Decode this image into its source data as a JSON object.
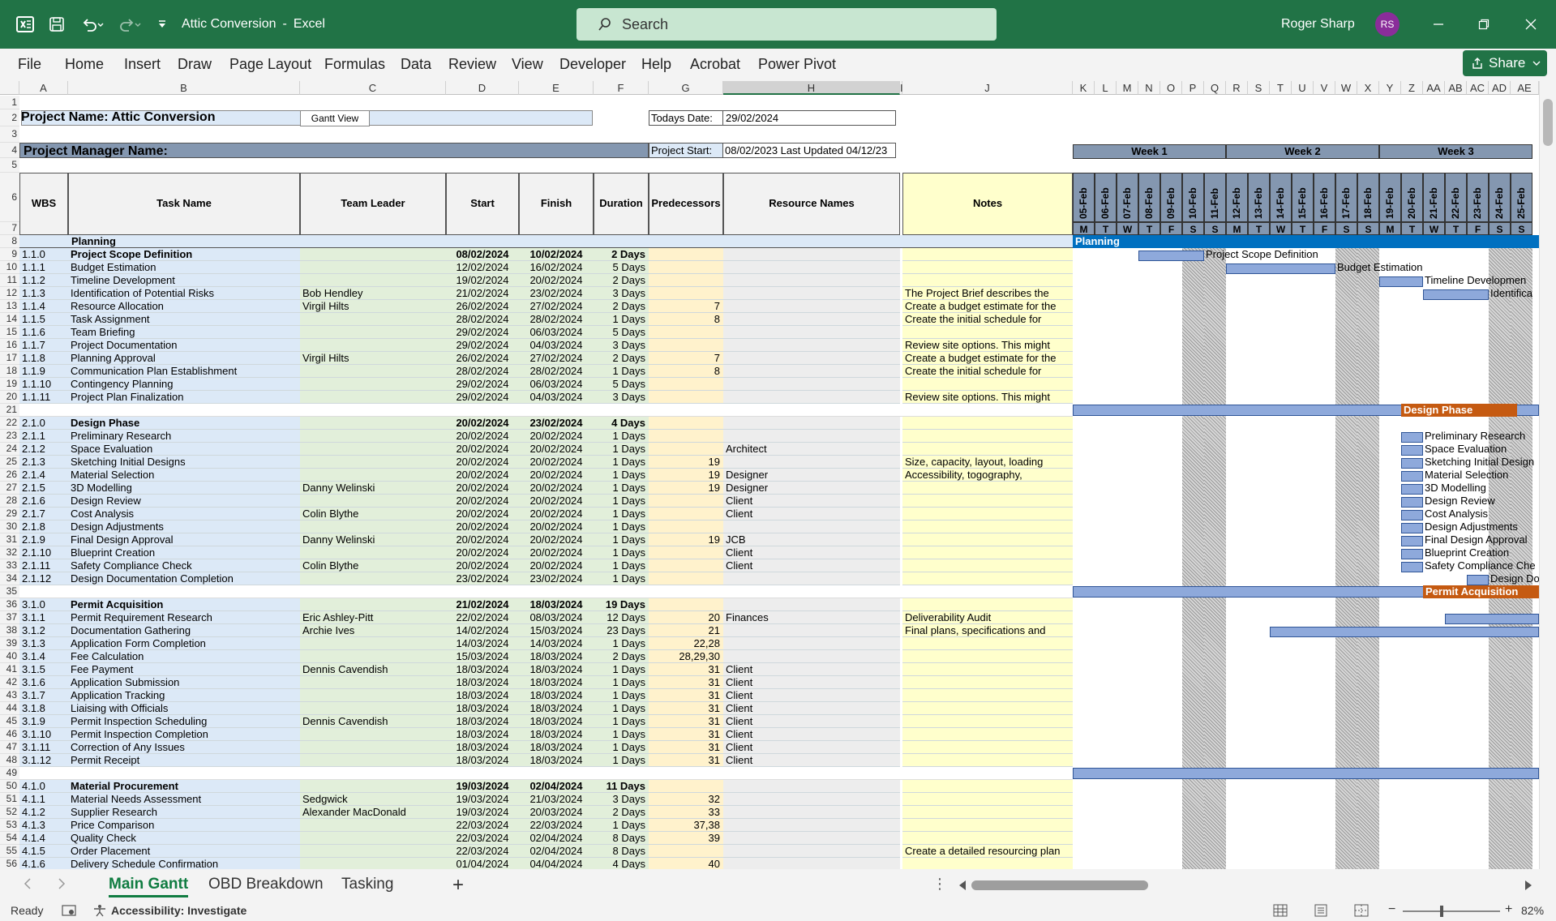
{
  "title_bar": {
    "file_title": "Attic Conversion",
    "app": "Excel",
    "title_sep": "-",
    "search_placeholder": "Search",
    "user_name": "Roger Sharp",
    "user_initials": "RS"
  },
  "menu": [
    "File",
    "Home",
    "Insert",
    "Draw",
    "Page Layout",
    "Formulas",
    "Data",
    "Review",
    "View",
    "Developer",
    "Help",
    "Acrobat",
    "Power Pivot"
  ],
  "share_label": "Share",
  "columns": [
    "A",
    "B",
    "C",
    "D",
    "E",
    "F",
    "G",
    "H",
    "I",
    "J",
    "K",
    "L",
    "M",
    "N",
    "O",
    "P",
    "Q",
    "R",
    "S",
    "T",
    "U",
    "V",
    "W",
    "X",
    "Y",
    "Z",
    "AA",
    "AB",
    "AC",
    "AD",
    "AE"
  ],
  "sheet": {
    "project_name": "Project Name: Attic Conversion",
    "gantt_button": "Gantt View",
    "todays_date_label": "Todays Date:",
    "todays_date": "29/02/2024",
    "project_manager": "Project Manager Name:",
    "project_start_label": "Project Start:",
    "project_start": "08/02/2023 Last Updated 04/12/23",
    "headers": [
      "WBS",
      "Task Name",
      "Team Leader",
      "Start",
      "Finish",
      "Duration",
      "Predecessors",
      "Resource Names",
      "Notes"
    ],
    "weeks": [
      "Week 1",
      "Week 2",
      "Week 3"
    ],
    "dates": [
      "05-Feb",
      "06-Feb",
      "07-Feb",
      "08-Feb",
      "09-Feb",
      "10-Feb",
      "11-Feb",
      "12-Feb",
      "13-Feb",
      "14-Feb",
      "15-Feb",
      "16-Feb",
      "17-Feb",
      "18-Feb",
      "19-Feb",
      "20-Feb",
      "21-Feb",
      "22-Feb",
      "23-Feb",
      "24-Feb",
      "25-Feb"
    ],
    "days": [
      "M",
      "T",
      "W",
      "T",
      "F",
      "S",
      "S",
      "M",
      "T",
      "W",
      "T",
      "F",
      "S",
      "S",
      "M",
      "T",
      "W",
      "T",
      "F",
      "S",
      "S"
    ],
    "rows": [
      {
        "r": "8",
        "wbs": "",
        "task": "Planning",
        "lead": "",
        "start": "",
        "finish": "",
        "dur": "",
        "pred": "",
        "res": "",
        "notes": "",
        "type": "phase",
        "gantt": "Planning"
      },
      {
        "r": "9",
        "wbs": "1.1.0",
        "task": "Project Scope Definition",
        "lead": "",
        "start": "08/02/2024",
        "finish": "10/02/2024",
        "dur": "2 Days",
        "pred": "",
        "res": "",
        "notes": "",
        "bold": true
      },
      {
        "r": "10",
        "wbs": "1.1.1",
        "task": "Budget Estimation",
        "lead": "",
        "start": "12/02/2024",
        "finish": "16/02/2024",
        "dur": "5 Days",
        "pred": "",
        "res": "",
        "notes": ""
      },
      {
        "r": "11",
        "wbs": "1.1.2",
        "task": "Timeline Development",
        "lead": "",
        "start": "19/02/2024",
        "finish": "20/02/2024",
        "dur": "2 Days",
        "pred": "",
        "res": "",
        "notes": ""
      },
      {
        "r": "12",
        "wbs": "1.1.3",
        "task": "Identification of Potential Risks",
        "lead": "Bob Hendley",
        "start": "21/02/2024",
        "finish": "23/02/2024",
        "dur": "3 Days",
        "pred": "",
        "res": "",
        "notes": "The Project Brief describes the"
      },
      {
        "r": "13",
        "wbs": "1.1.4",
        "task": "Resource Allocation",
        "lead": "Virgil Hilts",
        "start": "26/02/2024",
        "finish": "27/02/2024",
        "dur": "2 Days",
        "pred": "7",
        "res": "",
        "notes": "Create a budget estimate for the"
      },
      {
        "r": "14",
        "wbs": "1.1.5",
        "task": "Task Assignment",
        "lead": "",
        "start": "28/02/2024",
        "finish": "28/02/2024",
        "dur": "1 Days",
        "pred": "8",
        "res": "",
        "notes": "Create the initial schedule for"
      },
      {
        "r": "15",
        "wbs": "1.1.6",
        "task": "Team Briefing",
        "lead": "",
        "start": "29/02/2024",
        "finish": "06/03/2024",
        "dur": "5 Days",
        "pred": "",
        "res": "",
        "notes": ""
      },
      {
        "r": "16",
        "wbs": "1.1.7",
        "task": "Project Documentation",
        "lead": "",
        "start": "29/02/2024",
        "finish": "04/03/2024",
        "dur": "3 Days",
        "pred": "",
        "res": "",
        "notes": "Review site options. This might"
      },
      {
        "r": "17",
        "wbs": "1.1.8",
        "task": "Planning Approval",
        "lead": "Virgil Hilts",
        "start": "26/02/2024",
        "finish": "27/02/2024",
        "dur": "2 Days",
        "pred": "7",
        "res": "",
        "notes": "Create a budget estimate for the"
      },
      {
        "r": "18",
        "wbs": "1.1.9",
        "task": "Communication Plan Establishment",
        "lead": "",
        "start": "28/02/2024",
        "finish": "28/02/2024",
        "dur": "1 Days",
        "pred": "8",
        "res": "",
        "notes": "Create the initial schedule for"
      },
      {
        "r": "19",
        "wbs": "1.1.10",
        "task": "Contingency Planning",
        "lead": "",
        "start": "29/02/2024",
        "finish": "06/03/2024",
        "dur": "5 Days",
        "pred": "",
        "res": "",
        "notes": ""
      },
      {
        "r": "20",
        "wbs": "1.1.11",
        "task": "Project Plan Finalization",
        "lead": "",
        "start": "29/02/2024",
        "finish": "04/03/2024",
        "dur": "3 Days",
        "pred": "",
        "res": "",
        "notes": "Review site options. This might"
      },
      {
        "r": "21",
        "type": "blank",
        "gantt": "Design Phase"
      },
      {
        "r": "22",
        "wbs": "2.1.0",
        "task": "Design Phase",
        "lead": "",
        "start": "20/02/2024",
        "finish": "23/02/2024",
        "dur": "4 Days",
        "pred": "",
        "res": "",
        "notes": "",
        "bold": true
      },
      {
        "r": "23",
        "wbs": "2.1.1",
        "task": "Preliminary Research",
        "lead": "",
        "start": "20/02/2024",
        "finish": "20/02/2024",
        "dur": "1 Days",
        "pred": "",
        "res": "",
        "notes": ""
      },
      {
        "r": "24",
        "wbs": "2.1.2",
        "task": "Space Evaluation",
        "lead": "",
        "start": "20/02/2024",
        "finish": "20/02/2024",
        "dur": "1 Days",
        "pred": "",
        "res": "Architect",
        "notes": ""
      },
      {
        "r": "25",
        "wbs": "2.1.3",
        "task": "Sketching Initial Designs",
        "lead": "",
        "start": "20/02/2024",
        "finish": "20/02/2024",
        "dur": "1 Days",
        "pred": "19",
        "res": "",
        "notes": "Size, capacity, layout, loading"
      },
      {
        "r": "26",
        "wbs": "2.1.4",
        "task": "Material Selection",
        "lead": "",
        "start": "20/02/2024",
        "finish": "20/02/2024",
        "dur": "1 Days",
        "pred": "19",
        "res": "Designer",
        "notes": "Accessibility, togography,"
      },
      {
        "r": "27",
        "wbs": "2.1.5",
        "task": "3D Modelling",
        "lead": "Danny Welinski",
        "start": "20/02/2024",
        "finish": "20/02/2024",
        "dur": "1 Days",
        "pred": "19",
        "res": "Designer",
        "notes": ""
      },
      {
        "r": "28",
        "wbs": "2.1.6",
        "task": "Design Review",
        "lead": "",
        "start": "20/02/2024",
        "finish": "20/02/2024",
        "dur": "1 Days",
        "pred": "",
        "res": "Client",
        "notes": ""
      },
      {
        "r": "29",
        "wbs": "2.1.7",
        "task": "Cost Analysis",
        "lead": "Colin Blythe",
        "start": "20/02/2024",
        "finish": "20/02/2024",
        "dur": "1 Days",
        "pred": "",
        "res": "Client",
        "notes": ""
      },
      {
        "r": "30",
        "wbs": "2.1.8",
        "task": "Design Adjustments",
        "lead": "",
        "start": "20/02/2024",
        "finish": "20/02/2024",
        "dur": "1 Days",
        "pred": "",
        "res": "",
        "notes": ""
      },
      {
        "r": "31",
        "wbs": "2.1.9",
        "task": "Final Design Approval",
        "lead": "Danny Welinski",
        "start": "20/02/2024",
        "finish": "20/02/2024",
        "dur": "1 Days",
        "pred": "19",
        "res": "JCB",
        "notes": ""
      },
      {
        "r": "32",
        "wbs": "2.1.10",
        "task": "Blueprint Creation",
        "lead": "",
        "start": "20/02/2024",
        "finish": "20/02/2024",
        "dur": "1 Days",
        "pred": "",
        "res": "Client",
        "notes": ""
      },
      {
        "r": "33",
        "wbs": "2.1.11",
        "task": "Safety Compliance Check",
        "lead": "Colin Blythe",
        "start": "20/02/2024",
        "finish": "20/02/2024",
        "dur": "1 Days",
        "pred": "",
        "res": "Client",
        "notes": ""
      },
      {
        "r": "34",
        "wbs": "2.1.12",
        "task": "Design Documentation Completion",
        "lead": "",
        "start": "23/02/2024",
        "finish": "23/02/2024",
        "dur": "1 Days",
        "pred": "",
        "res": "",
        "notes": ""
      },
      {
        "r": "35",
        "type": "blank",
        "gantt": "Permit Acquisition"
      },
      {
        "r": "36",
        "wbs": "3.1.0",
        "task": "Permit Acquisition",
        "lead": "",
        "start": "21/02/2024",
        "finish": "18/03/2024",
        "dur": "19 Days",
        "pred": "",
        "res": "",
        "notes": "",
        "bold": true
      },
      {
        "r": "37",
        "wbs": "3.1.1",
        "task": "Permit Requirement Research",
        "lead": "Eric Ashley-Pitt",
        "start": "22/02/2024",
        "finish": "08/03/2024",
        "dur": "12 Days",
        "pred": "20",
        "res": "Finances",
        "notes": "Deliverability Audit"
      },
      {
        "r": "38",
        "wbs": "3.1.2",
        "task": "Documentation Gathering",
        "lead": "Archie Ives",
        "start": "14/02/2024",
        "finish": "15/03/2024",
        "dur": "23 Days",
        "pred": "21",
        "res": "",
        "notes": "Final plans, specifications and"
      },
      {
        "r": "39",
        "wbs": "3.1.3",
        "task": "Application Form Completion",
        "lead": "",
        "start": "14/03/2024",
        "finish": "14/03/2024",
        "dur": "1 Days",
        "pred": "22,28",
        "res": "",
        "notes": ""
      },
      {
        "r": "40",
        "wbs": "3.1.4",
        "task": "Fee Calculation",
        "lead": "",
        "start": "15/03/2024",
        "finish": "18/03/2024",
        "dur": "2 Days",
        "pred": "28,29,30",
        "res": "",
        "notes": ""
      },
      {
        "r": "41",
        "wbs": "3.1.5",
        "task": "Fee Payment",
        "lead": "Dennis Cavendish",
        "start": "18/03/2024",
        "finish": "18/03/2024",
        "dur": "1 Days",
        "pred": "31",
        "res": "Client",
        "notes": ""
      },
      {
        "r": "42",
        "wbs": "3.1.6",
        "task": "Application Submission",
        "lead": "",
        "start": "18/03/2024",
        "finish": "18/03/2024",
        "dur": "1 Days",
        "pred": "31",
        "res": "Client",
        "notes": ""
      },
      {
        "r": "43",
        "wbs": "3.1.7",
        "task": "Application Tracking",
        "lead": "",
        "start": "18/03/2024",
        "finish": "18/03/2024",
        "dur": "1 Days",
        "pred": "31",
        "res": "Client",
        "notes": ""
      },
      {
        "r": "44",
        "wbs": "3.1.8",
        "task": "Liaising with Officials",
        "lead": "",
        "start": "18/03/2024",
        "finish": "18/03/2024",
        "dur": "1 Days",
        "pred": "31",
        "res": "Client",
        "notes": ""
      },
      {
        "r": "45",
        "wbs": "3.1.9",
        "task": "Permit Inspection Scheduling",
        "lead": "Dennis Cavendish",
        "start": "18/03/2024",
        "finish": "18/03/2024",
        "dur": "1 Days",
        "pred": "31",
        "res": "Client",
        "notes": ""
      },
      {
        "r": "46",
        "wbs": "3.1.10",
        "task": "Permit Inspection Completion",
        "lead": "",
        "start": "18/03/2024",
        "finish": "18/03/2024",
        "dur": "1 Days",
        "pred": "31",
        "res": "Client",
        "notes": ""
      },
      {
        "r": "47",
        "wbs": "3.1.11",
        "task": "Correction of Any Issues",
        "lead": "",
        "start": "18/03/2024",
        "finish": "18/03/2024",
        "dur": "1 Days",
        "pred": "31",
        "res": "Client",
        "notes": ""
      },
      {
        "r": "48",
        "wbs": "3.1.12",
        "task": "Permit Receipt",
        "lead": "",
        "start": "18/03/2024",
        "finish": "18/03/2024",
        "dur": "1 Days",
        "pred": "31",
        "res": "Client",
        "notes": ""
      },
      {
        "r": "49",
        "type": "blank",
        "gantt": ""
      },
      {
        "r": "50",
        "wbs": "4.1.0",
        "task": "Material Procurement",
        "lead": "",
        "start": "19/03/2024",
        "finish": "02/04/2024",
        "dur": "11 Days",
        "pred": "",
        "res": "",
        "notes": "",
        "bold": true
      },
      {
        "r": "51",
        "wbs": "4.1.1",
        "task": "Material Needs Assessment",
        "lead": "Sedgwick",
        "start": "19/03/2024",
        "finish": "21/03/2024",
        "dur": "3 Days",
        "pred": "32",
        "res": "",
        "notes": ""
      },
      {
        "r": "52",
        "wbs": "4.1.2",
        "task": "Supplier Research",
        "lead": "Alexander MacDonald",
        "start": "19/03/2024",
        "finish": "20/03/2024",
        "dur": "2 Days",
        "pred": "33",
        "res": "",
        "notes": ""
      },
      {
        "r": "53",
        "wbs": "4.1.3",
        "task": "Price Comparison",
        "lead": "",
        "start": "22/03/2024",
        "finish": "22/03/2024",
        "dur": "1 Days",
        "pred": "37,38",
        "res": "",
        "notes": ""
      },
      {
        "r": "54",
        "wbs": "4.1.4",
        "task": "Quality Check",
        "lead": "",
        "start": "22/03/2024",
        "finish": "02/04/2024",
        "dur": "8 Days",
        "pred": "39",
        "res": "",
        "notes": ""
      },
      {
        "r": "55",
        "wbs": "4.1.5",
        "task": "Order Placement",
        "lead": "",
        "start": "22/03/2024",
        "finish": "02/04/2024",
        "dur": "8 Days",
        "pred": "",
        "res": "",
        "notes": "Create a detailed resourcing plan"
      },
      {
        "r": "56",
        "wbs": "4.1.6",
        "task": "Delivery Schedule Confirmation",
        "lead": "",
        "start": "01/04/2024",
        "finish": "04/04/2024",
        "dur": "4 Days",
        "pred": "40",
        "res": "",
        "notes": ""
      }
    ],
    "gantt_labels": [
      {
        "row": "9",
        "label": "Project Scope Definition"
      },
      {
        "row": "10",
        "label": "Budget Estimation"
      },
      {
        "row": "11",
        "label": "Timeline Developmen"
      },
      {
        "row": "12",
        "label": "Identifica"
      },
      {
        "row": "23",
        "label": "Preliminary Research"
      },
      {
        "row": "24",
        "label": "Space Evaluation"
      },
      {
        "row": "25",
        "label": "Sketching Initial Design"
      },
      {
        "row": "26",
        "label": "Material Selection"
      },
      {
        "row": "27",
        "label": "3D Modelling"
      },
      {
        "row": "28",
        "label": "Design Review"
      },
      {
        "row": "29",
        "label": "Cost Analysis"
      },
      {
        "row": "30",
        "label": "Design Adjustments"
      },
      {
        "row": "31",
        "label": "Final Design Approval"
      },
      {
        "row": "32",
        "label": "Blueprint Creation"
      },
      {
        "row": "33",
        "label": "Safety Compliance Che"
      },
      {
        "row": "34",
        "label": "Design Do"
      }
    ]
  },
  "sheet_tabs": [
    "Main Gantt",
    "OBD Breakdown",
    "Tasking"
  ],
  "active_tab": "Main Gantt",
  "status": {
    "ready": "Ready",
    "accessibility": "Accessibility: Investigate",
    "zoom": "82%"
  },
  "colors": {
    "excel_green": "#217346",
    "phase_blue": "#0070c0",
    "phase_orange": "#c55a11",
    "bar_blue": "#8ea9db",
    "header_blue": "#8497b0"
  }
}
